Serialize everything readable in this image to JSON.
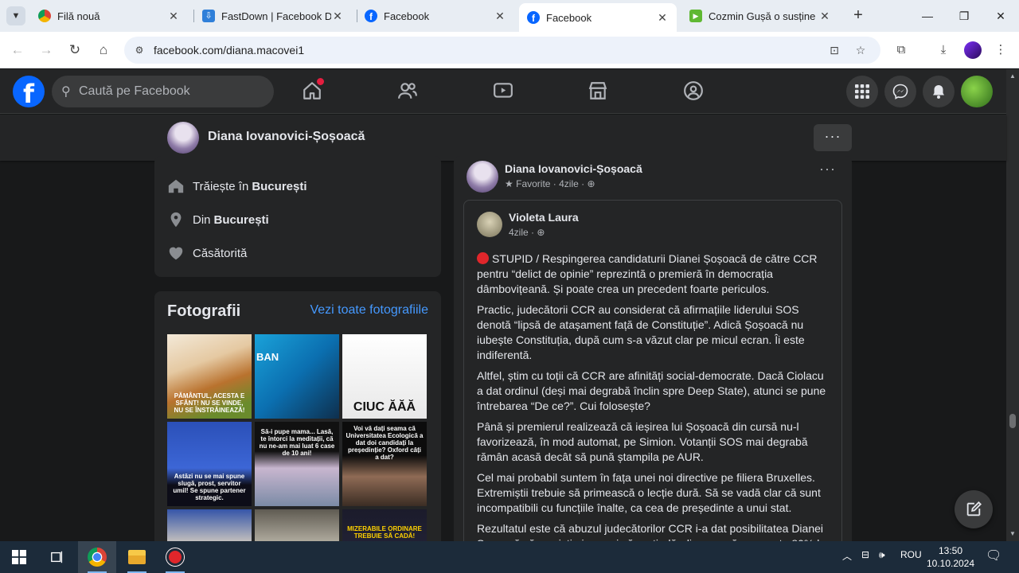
{
  "browser": {
    "tabs": [
      {
        "title": "Filă nouă",
        "favicon": "chrome-icon"
      },
      {
        "title": "FastDown | Facebook Downloader",
        "favicon": "download-icon"
      },
      {
        "title": "Facebook",
        "favicon": "facebook-icon"
      },
      {
        "title": "Facebook",
        "favicon": "facebook-icon",
        "active": true
      },
      {
        "title": "Cozmin Gușă o susține pe Diana",
        "favicon": "play-icon"
      }
    ],
    "url": "facebook.com/diana.macovei1"
  },
  "facebook": {
    "search_placeholder": "Caută pe Facebook",
    "profile_name": "Diana Iovanovici-Șoșoacă",
    "intro": [
      {
        "prefix": "Trăiește în",
        "bold": "București",
        "icon": "home-icon"
      },
      {
        "prefix": "Din",
        "bold": "București",
        "icon": "location-pin-icon"
      },
      {
        "prefix": "Căsătorită",
        "bold": "",
        "icon": "heart-icon"
      }
    ],
    "photos": {
      "title": "Fotografii",
      "see_all": "Vezi toate fotografiile",
      "captions": [
        "PĂMÂNTUL, ACESTA E SFÂNT! NU SE VINDE, NU SE ÎNSTRĂINEAZĂ!",
        "BAN",
        "CIUC   ĂĂĂ",
        "Astăzi nu se mai spune slugă, prost, servitor umil! Se spune partener strategic.",
        "Să-i pupe mama... Lasă, te întorci la meditații, că nu ne-am mai luat 6 case de 10 ani!",
        "Voi vă dați seama că Universitatea Ecologică a dat doi candidați la președinție? Oxford câți a dat?",
        "",
        "",
        "MIZERABILE ORDINARE TREBUIE SĂ CADĂ!"
      ]
    },
    "post": {
      "author": "Diana Iovanovici-Șoșoacă",
      "meta": "Favorite · 4zile ·",
      "shared_author": "Violeta Laura",
      "shared_meta": "4zile ·",
      "paragraphs": [
        "STUPID / Respingerea candidaturii Dianei Șoșoacă de către CCR pentru “delict de opinie” reprezintă o premieră în democrația dâmbovițeană. Și poate crea un precedent foarte periculos.",
        "Practic, judecătorii CCR au considerat că afirmațiile liderului SOS denotă “lipsă de atașament față de Constituție”. Adică Șoșoacă nu iubește Constituția, după cum s-a văzut clar pe micul ecran. Îi este indiferentă.",
        "Altfel, știm cu toții că CCR are afinități social-democrate. Dacă Ciolacu a dat ordinul (deși mai degrabă înclin spre Deep State), atunci se pune întrebarea “De ce?”. Cui folosește?",
        "Până și premierul realizează că ieșirea lui Șoșoacă din cursă nu-l favorizează, în mod automat, pe Simion. Votanții SOS mai degrabă rămân acasă decât să pună ștampila pe AUR.",
        "Cel mai probabil suntem în fața unei noi directive pe filiera Bruxelles. Extremiștii trebuie să primească o lecție dură. Să se vadă clar că sunt incompatibili cu funcțiile înalte, ca cea de președinte a unui stat.",
        "Rezultatul este că abuzul judecătorilor CCR i-a dat posibilitatea Dianei Șoșoacă să se victimizeze și să pretindă, din nou, că va scoate 80% la alegerile parlamentare. Și îl va demite imediat pe viitorul președinte."
      ]
    }
  },
  "taskbar": {
    "lang": "ROU",
    "time": "13:50",
    "date": "10.10.2024"
  },
  "colors": {
    "fb_blue": "#0866ff",
    "link_blue": "#4599ff",
    "surface": "#242526",
    "background": "#18191a"
  }
}
